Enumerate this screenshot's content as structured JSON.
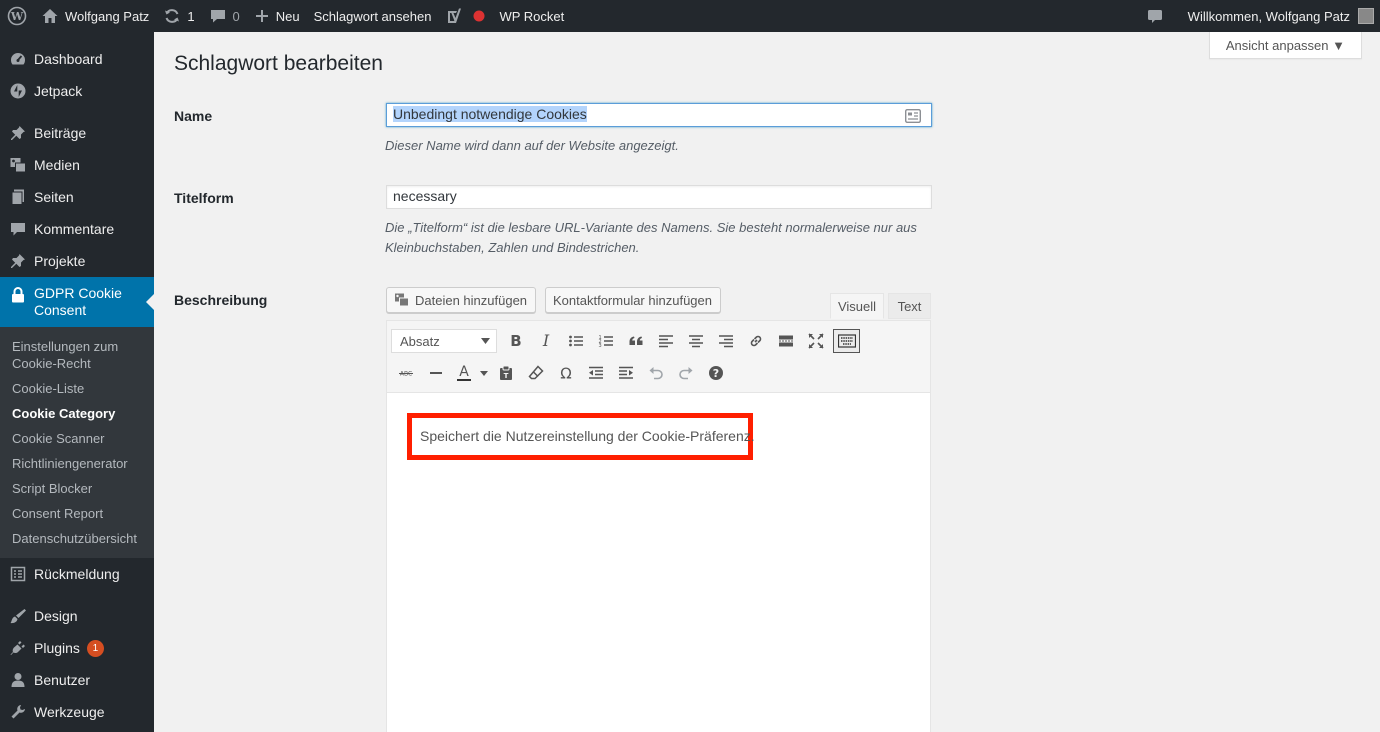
{
  "adminbar": {
    "site_name": "Wolfgang Patz",
    "updates_count": "1",
    "comments_count": "0",
    "new_label": "Neu",
    "view_tag_label": "Schlagwort ansehen",
    "rocket_label": "WP Rocket",
    "greeting": "Willkommen, Wolfgang Patz"
  },
  "sidebar": {
    "top_items": [
      {
        "label": "Dashboard",
        "icon": "dashboard-icon"
      },
      {
        "label": "Jetpack",
        "icon": "jetpack-icon"
      }
    ],
    "content_items": [
      {
        "label": "Beiträge",
        "icon": "pin-icon"
      },
      {
        "label": "Medien",
        "icon": "media-icon"
      },
      {
        "label": "Seiten",
        "icon": "pages-icon"
      },
      {
        "label": "Kommentare",
        "icon": "comments-icon"
      },
      {
        "label": "Projekte",
        "icon": "pin-icon"
      }
    ],
    "active_item": {
      "label": "GDPR Cookie Consent",
      "icon": "lock-icon"
    },
    "submenu": [
      "Einstellungen zum Cookie-Recht",
      "Cookie-Liste",
      "Cookie Category",
      "Cookie Scanner",
      "Richtliniengenerator",
      "Script Blocker",
      "Consent Report",
      "Datenschutzübersicht"
    ],
    "current_submenu": "Cookie Category",
    "feedback_item": {
      "label": "Rückmeldung",
      "icon": "feedback-icon"
    },
    "admin_items": [
      {
        "label": "Design",
        "icon": "brush-icon"
      },
      {
        "label": "Plugins",
        "icon": "plugins-icon",
        "badge": "1"
      },
      {
        "label": "Benutzer",
        "icon": "users-icon"
      },
      {
        "label": "Werkzeuge",
        "icon": "tools-icon"
      }
    ]
  },
  "screen_options_label": "Ansicht anpassen ▼",
  "page_title": "Schlagwort bearbeiten",
  "form": {
    "name_label": "Name",
    "name_value": "Unbedingt notwendige Cookies",
    "name_desc": "Dieser Name wird dann auf der Website angezeigt.",
    "slug_label": "Titelform",
    "slug_value": "necessary",
    "slug_desc": "Die „Titelform“ ist die lesbare URL-Variante des Namens. Sie besteht normalerweise nur aus Kleinbuchstaben, Zahlen und Bindestrichen.",
    "desc_label": "Beschreibung"
  },
  "editor": {
    "add_media_label": "Dateien hinzufügen",
    "add_form_label": "Kontaktformular hinzufügen",
    "tab_visual": "Visuell",
    "tab_text": "Text",
    "format_select": "Absatz",
    "content": "Speichert die Nutzereinstellung der Cookie-Präferenz.",
    "highlight_color": "#ff1f00"
  },
  "colors": {
    "admin_bg": "#23282d",
    "accent": "#0073aa",
    "badge": "#d54e21"
  }
}
